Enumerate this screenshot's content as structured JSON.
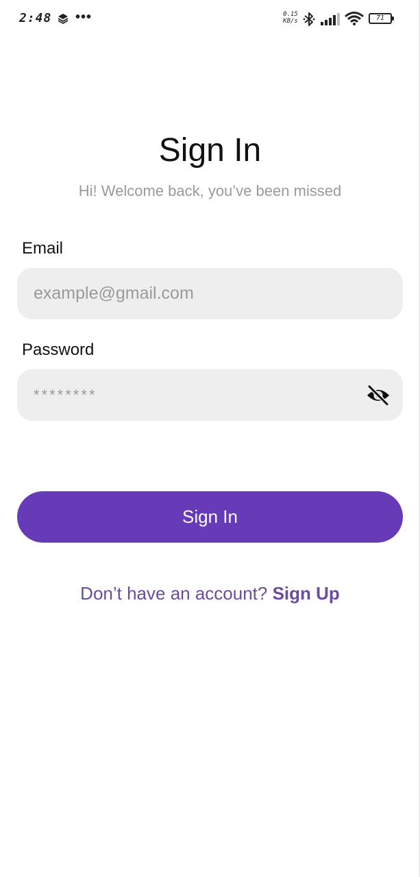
{
  "status_bar": {
    "time": "2:48",
    "more": "•••",
    "speed_value": "0.15",
    "speed_unit": "KB/s",
    "battery": "71"
  },
  "header": {
    "title": "Sign In",
    "subtitle": "Hi! Welcome back, you’ve been missed"
  },
  "form": {
    "email_label": "Email",
    "email_placeholder": "example@gmail.com",
    "email_value": "",
    "password_label": "Password",
    "password_placeholder": "********",
    "password_value": ""
  },
  "actions": {
    "signin_label": "Sign In",
    "signup_prompt": "Don’t have an account? ",
    "signup_link": "Sign Up"
  },
  "colors": {
    "primary": "#673ab7",
    "link": "#6a4b9e",
    "input_bg": "#eeeeee",
    "subtitle": "#9a9a9a"
  },
  "icons": {
    "status": [
      "layers-icon",
      "more-icon",
      "bluetooth-icon",
      "signal-icon",
      "wifi-icon",
      "battery-icon"
    ],
    "password_toggle": "eye-off-icon"
  }
}
